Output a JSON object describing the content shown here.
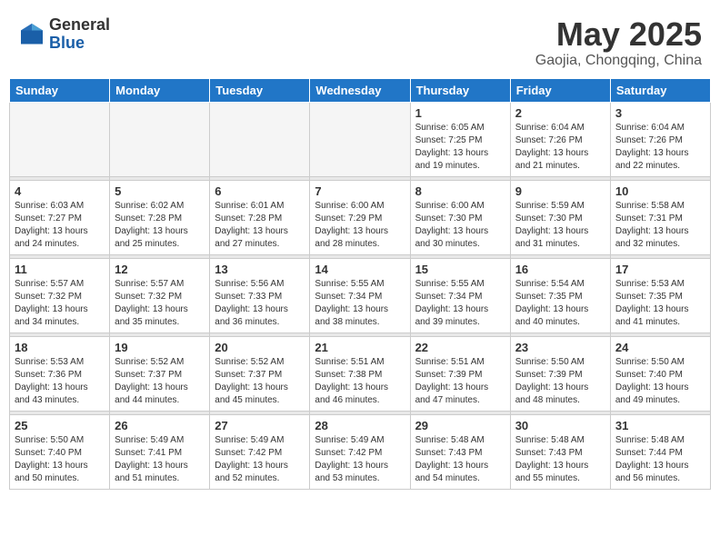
{
  "logo": {
    "general": "General",
    "blue": "Blue"
  },
  "title": "May 2025",
  "subtitle": "Gaojia, Chongqing, China",
  "weekdays": [
    "Sunday",
    "Monday",
    "Tuesday",
    "Wednesday",
    "Thursday",
    "Friday",
    "Saturday"
  ],
  "weeks": [
    [
      {
        "day": "",
        "info": ""
      },
      {
        "day": "",
        "info": ""
      },
      {
        "day": "",
        "info": ""
      },
      {
        "day": "",
        "info": ""
      },
      {
        "day": "1",
        "info": "Sunrise: 6:05 AM\nSunset: 7:25 PM\nDaylight: 13 hours and 19 minutes."
      },
      {
        "day": "2",
        "info": "Sunrise: 6:04 AM\nSunset: 7:26 PM\nDaylight: 13 hours and 21 minutes."
      },
      {
        "day": "3",
        "info": "Sunrise: 6:04 AM\nSunset: 7:26 PM\nDaylight: 13 hours and 22 minutes."
      }
    ],
    [
      {
        "day": "4",
        "info": "Sunrise: 6:03 AM\nSunset: 7:27 PM\nDaylight: 13 hours and 24 minutes."
      },
      {
        "day": "5",
        "info": "Sunrise: 6:02 AM\nSunset: 7:28 PM\nDaylight: 13 hours and 25 minutes."
      },
      {
        "day": "6",
        "info": "Sunrise: 6:01 AM\nSunset: 7:28 PM\nDaylight: 13 hours and 27 minutes."
      },
      {
        "day": "7",
        "info": "Sunrise: 6:00 AM\nSunset: 7:29 PM\nDaylight: 13 hours and 28 minutes."
      },
      {
        "day": "8",
        "info": "Sunrise: 6:00 AM\nSunset: 7:30 PM\nDaylight: 13 hours and 30 minutes."
      },
      {
        "day": "9",
        "info": "Sunrise: 5:59 AM\nSunset: 7:30 PM\nDaylight: 13 hours and 31 minutes."
      },
      {
        "day": "10",
        "info": "Sunrise: 5:58 AM\nSunset: 7:31 PM\nDaylight: 13 hours and 32 minutes."
      }
    ],
    [
      {
        "day": "11",
        "info": "Sunrise: 5:57 AM\nSunset: 7:32 PM\nDaylight: 13 hours and 34 minutes."
      },
      {
        "day": "12",
        "info": "Sunrise: 5:57 AM\nSunset: 7:32 PM\nDaylight: 13 hours and 35 minutes."
      },
      {
        "day": "13",
        "info": "Sunrise: 5:56 AM\nSunset: 7:33 PM\nDaylight: 13 hours and 36 minutes."
      },
      {
        "day": "14",
        "info": "Sunrise: 5:55 AM\nSunset: 7:34 PM\nDaylight: 13 hours and 38 minutes."
      },
      {
        "day": "15",
        "info": "Sunrise: 5:55 AM\nSunset: 7:34 PM\nDaylight: 13 hours and 39 minutes."
      },
      {
        "day": "16",
        "info": "Sunrise: 5:54 AM\nSunset: 7:35 PM\nDaylight: 13 hours and 40 minutes."
      },
      {
        "day": "17",
        "info": "Sunrise: 5:53 AM\nSunset: 7:35 PM\nDaylight: 13 hours and 41 minutes."
      }
    ],
    [
      {
        "day": "18",
        "info": "Sunrise: 5:53 AM\nSunset: 7:36 PM\nDaylight: 13 hours and 43 minutes."
      },
      {
        "day": "19",
        "info": "Sunrise: 5:52 AM\nSunset: 7:37 PM\nDaylight: 13 hours and 44 minutes."
      },
      {
        "day": "20",
        "info": "Sunrise: 5:52 AM\nSunset: 7:37 PM\nDaylight: 13 hours and 45 minutes."
      },
      {
        "day": "21",
        "info": "Sunrise: 5:51 AM\nSunset: 7:38 PM\nDaylight: 13 hours and 46 minutes."
      },
      {
        "day": "22",
        "info": "Sunrise: 5:51 AM\nSunset: 7:39 PM\nDaylight: 13 hours and 47 minutes."
      },
      {
        "day": "23",
        "info": "Sunrise: 5:50 AM\nSunset: 7:39 PM\nDaylight: 13 hours and 48 minutes."
      },
      {
        "day": "24",
        "info": "Sunrise: 5:50 AM\nSunset: 7:40 PM\nDaylight: 13 hours and 49 minutes."
      }
    ],
    [
      {
        "day": "25",
        "info": "Sunrise: 5:50 AM\nSunset: 7:40 PM\nDaylight: 13 hours and 50 minutes."
      },
      {
        "day": "26",
        "info": "Sunrise: 5:49 AM\nSunset: 7:41 PM\nDaylight: 13 hours and 51 minutes."
      },
      {
        "day": "27",
        "info": "Sunrise: 5:49 AM\nSunset: 7:42 PM\nDaylight: 13 hours and 52 minutes."
      },
      {
        "day": "28",
        "info": "Sunrise: 5:49 AM\nSunset: 7:42 PM\nDaylight: 13 hours and 53 minutes."
      },
      {
        "day": "29",
        "info": "Sunrise: 5:48 AM\nSunset: 7:43 PM\nDaylight: 13 hours and 54 minutes."
      },
      {
        "day": "30",
        "info": "Sunrise: 5:48 AM\nSunset: 7:43 PM\nDaylight: 13 hours and 55 minutes."
      },
      {
        "day": "31",
        "info": "Sunrise: 5:48 AM\nSunset: 7:44 PM\nDaylight: 13 hours and 56 minutes."
      }
    ]
  ]
}
